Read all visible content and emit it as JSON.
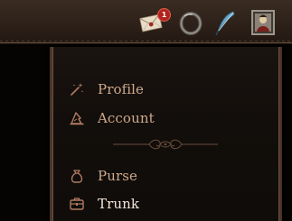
{
  "topbar": {
    "notifications": {
      "icon": "envelope-icon",
      "count": "1"
    },
    "ring": {
      "icon": "ring-icon"
    },
    "quill": {
      "icon": "quill-icon"
    },
    "portrait": {
      "icon": "portrait-icon"
    }
  },
  "menu": {
    "items": [
      {
        "label": "Profile",
        "icon": "magic-wand-icon"
      },
      {
        "label": "Account",
        "icon": "wizard-hat-icon"
      },
      {
        "label": "Purse",
        "icon": "coin-purse-icon"
      },
      {
        "label": "Trunk",
        "icon": "trunk-icon",
        "active": true
      }
    ],
    "divider_icon": "flourish-divider-icon"
  },
  "colors": {
    "label": "#cfa98c",
    "label_active": "#f3e6d8",
    "icon": "#b07c62",
    "badge": "#b3231d",
    "topbar": "#2d2119",
    "panel_border": "#4a3527"
  }
}
